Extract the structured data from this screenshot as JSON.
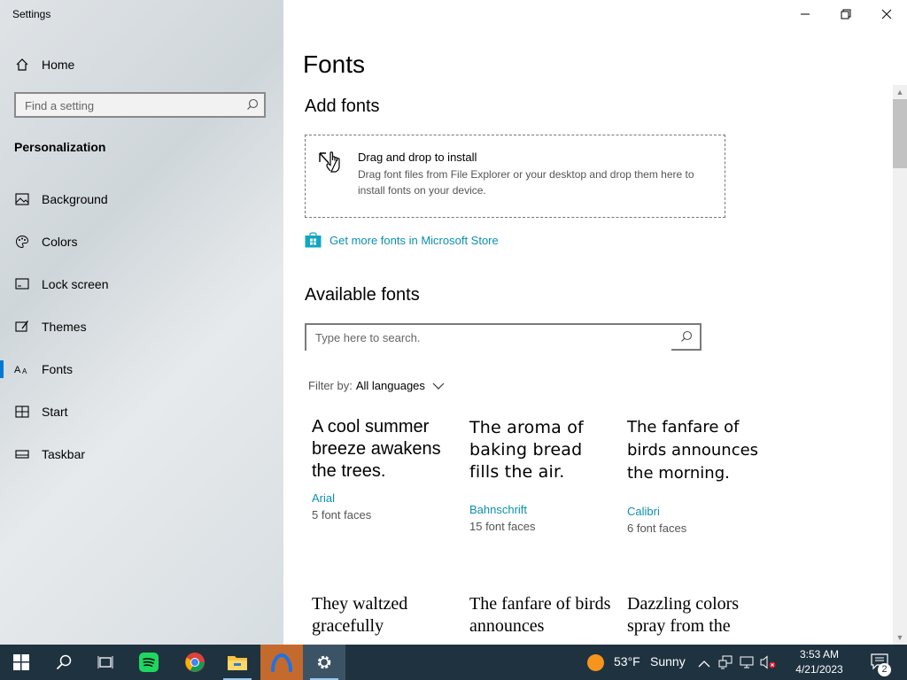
{
  "window": {
    "title": "Settings"
  },
  "sidebar": {
    "home_label": "Home",
    "search_placeholder": "Find a setting",
    "section_heading": "Personalization",
    "items": [
      {
        "label": "Background",
        "icon": "picture-icon"
      },
      {
        "label": "Colors",
        "icon": "palette-icon"
      },
      {
        "label": "Lock screen",
        "icon": "lock-screen-icon"
      },
      {
        "label": "Themes",
        "icon": "themes-icon"
      },
      {
        "label": "Fonts",
        "icon": "font-icon",
        "active": true
      },
      {
        "label": "Start",
        "icon": "start-grid-icon"
      },
      {
        "label": "Taskbar",
        "icon": "taskbar-icon"
      }
    ]
  },
  "main": {
    "title": "Fonts",
    "add_fonts_heading": "Add fonts",
    "drop_title": "Drag and drop to install",
    "drop_desc": "Drag font files from File Explorer or your desktop and drop them here to install fonts on your device.",
    "store_link": "Get more fonts in Microsoft Store",
    "available_heading": "Available fonts",
    "search_placeholder": "Type here to search.",
    "filter_label": "Filter by:",
    "filter_value": "All languages",
    "fonts": [
      {
        "sample": "A cool summer breeze awakens the trees.",
        "name": "Arial",
        "faces": "5 font faces"
      },
      {
        "sample": "The aroma of baking bread fills the air.",
        "name": "Bahnschrift",
        "faces": "15 font faces"
      },
      {
        "sample": "The fanfare of birds announces the morning.",
        "name": "Calibri",
        "faces": "6 font faces"
      },
      {
        "sample": "They waltzed gracefully",
        "name": "",
        "faces": ""
      },
      {
        "sample": "The fanfare of birds announces",
        "name": "",
        "faces": ""
      },
      {
        "sample": "Dazzling colors spray from the",
        "name": "",
        "faces": ""
      }
    ]
  },
  "taskbar": {
    "weather_temp": "53°F",
    "weather_cond": "Sunny",
    "time": "3:53 AM",
    "date": "4/21/2023",
    "notification_count": "2",
    "accent": "#1f3240"
  }
}
